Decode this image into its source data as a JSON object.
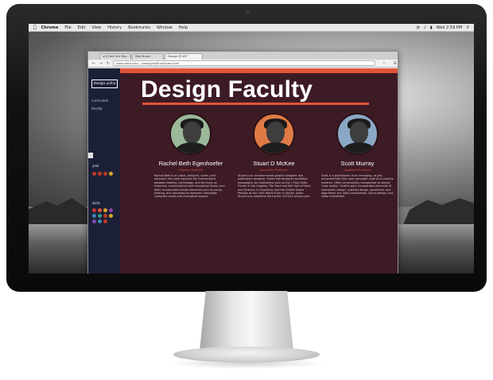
{
  "colors": {
    "accent": "#e1533a",
    "page_bg": "#3d1b25",
    "sidebar_bg": "#1c2036",
    "role_color": "#e1533a"
  },
  "menubar": {
    "apple_icon": "apple-icon",
    "items": [
      "Chrome",
      "File",
      "Edit",
      "View",
      "History",
      "Bookmarks",
      "Window",
      "Help"
    ],
    "clock": "Wed 2:59 PM"
  },
  "browser": {
    "tabs": [
      "u(f) Fact Hire Rep - Goo...",
      "Matt Bryan",
      "Design @ USF"
    ],
    "url": "www.usfca.edu/...views/peb/final/index.html"
  },
  "sidebar": {
    "logo": "design.usfca",
    "links": [
      "curriculum",
      "faculty"
    ],
    "filter_toggle": "‹",
    "year_label": "year",
    "year_colors": [
      "#c0392b",
      "#c0392b",
      "#c0392b",
      "#d9a52b"
    ],
    "skills_label": "skills",
    "skills_colors": [
      "#c0392b",
      "#e1533a",
      "#d9a52b",
      "#8e44ad",
      "#3f87b5",
      "#2f9e8f",
      "#c0392b",
      "#d9a52b",
      "#7a4bb0",
      "#3f87b5",
      "#c0392b"
    ]
  },
  "page": {
    "title": "Design Faculty"
  },
  "faculty": [
    {
      "name": "Rachel Beth Egenhoefer",
      "role": "Program Director",
      "bio": "Rachel Beth is an artist, designer, writer, and educator. Her work explores the intersections between textiles, technology, and the body on historical, constructional and conceptual levels; and often incorporates textile elements such as candy, knitting, and machines to represent intangible computer codes and conceptual spaces.",
      "ring_color": "#9bb99a"
    },
    {
      "name": "Stuart D McKee",
      "role": "Associate Professor",
      "bio": "Stuart is an environmental graphic designer and publication designer. Stuart has designed exhibition typography for institutions such as the J. Paul Getty Center in Los Angeles, The Rock and Roll Hall of Fame and Museum in Cleveland, and the United States Pavilion at the 1992 World's Fair in Seville, Spain. Stuart is on sabatical during the 2013/14 school year.",
      "ring_color": "#e07a45"
    },
    {
      "name": "Scott Murray",
      "role": "Assistant Professor",
      "bio": "Scott is a practitioner of an emerging, as-yet-unnamed field that uses computer code as a creative medium. Often conveniently categorized as simply \"new media,\" Scott's work incorporates elements of interaction design, systems design, generative and algorithmic art, data visualization, sound design, and video installation.",
      "ring_color": "#8ba7c6"
    }
  ]
}
